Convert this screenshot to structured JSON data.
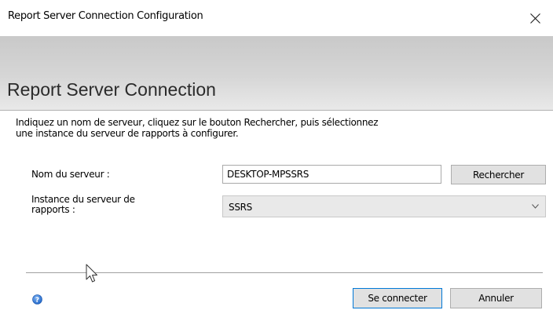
{
  "window": {
    "title": "Report Server Connection Configuration"
  },
  "banner": {
    "title": "Report Server Connection"
  },
  "description": {
    "line1": "Indiquez un nom de serveur, cliquez sur le bouton Rechercher, puis sélectionnez",
    "line2": "une instance du serveur de rapports à configurer."
  },
  "form": {
    "server_label": "Nom du serveur :",
    "server_value": "DESKTOP-MPSSRS",
    "search_label": "Rechercher",
    "instance_label_line1": "Instance du serveur de",
    "instance_label_line2": "rapports :",
    "instance_value": "SSRS"
  },
  "footer": {
    "connect_label": "Se connecter",
    "cancel_label": "Annuler"
  },
  "icons": {
    "close": "close-icon",
    "help": "help-icon",
    "dropdown": "chevron-down-icon",
    "cursor": "mouse-pointer-icon"
  },
  "colors": {
    "banner": "#d6d6d6",
    "default_button_border": "#0078d7",
    "help_icon": "#1c64c8"
  }
}
